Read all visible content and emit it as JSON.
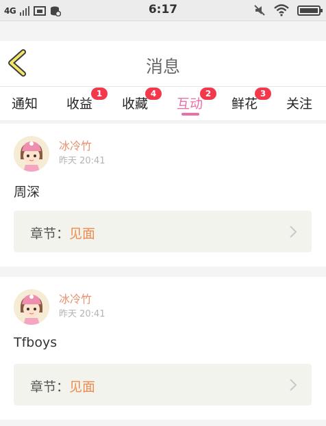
{
  "status_bar": {
    "network": "4G",
    "time": "6:17",
    "icons": [
      "signal-icon",
      "sim-icon",
      "data-saver-icon",
      "mute-icon",
      "wifi-icon",
      "battery-icon"
    ]
  },
  "header": {
    "title": "消息",
    "back_icon": "chevron-left-icon"
  },
  "tabs": [
    {
      "label": "通知",
      "badge": "",
      "active": false
    },
    {
      "label": "收益",
      "badge": "1",
      "active": false
    },
    {
      "label": "收藏",
      "badge": "4",
      "active": false
    },
    {
      "label": "互动",
      "badge": "2",
      "active": true
    },
    {
      "label": "鲜花",
      "badge": "3",
      "active": false
    },
    {
      "label": "关注",
      "badge": "",
      "active": false
    }
  ],
  "messages": [
    {
      "user": "冰冷竹",
      "time": "昨天 20:41",
      "content": "周深",
      "chapter_label": "章节：",
      "chapter_name": "见面"
    },
    {
      "user": "冰冷竹",
      "time": "昨天 20:41",
      "content": "Tfboys",
      "chapter_label": "章节：",
      "chapter_name": "见面"
    }
  ],
  "colors": {
    "accent_pink": "#ea6fa7",
    "badge_red": "#f2384a",
    "username_orange": "#e9906a",
    "chapter_orange": "#f0894d"
  }
}
